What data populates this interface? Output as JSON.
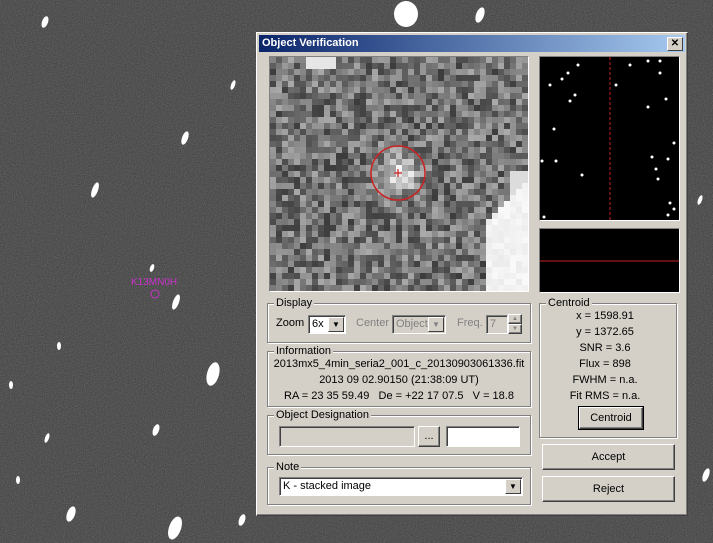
{
  "background": {
    "object_label": "K13MN0H"
  },
  "dialog": {
    "title": "Object Verification",
    "close_icon": "close-icon"
  },
  "display": {
    "group_label": "Display",
    "zoom_label": "Zoom",
    "zoom_value": "6x",
    "center_label": "Center",
    "center_value": "Object",
    "freq_label": "Freq.",
    "freq_value": "7"
  },
  "information": {
    "group_label": "Information",
    "filename": "2013mx5_4min_seria2_001_c_20130903061336.fit",
    "date": "2013 09 02.90150 (21:38:09 UT)",
    "coords": "RA = 23 35 59.49   De = +22 17 07.5   V = 18.8"
  },
  "designation": {
    "group_label": "Object Designation",
    "browse_label": "...",
    "field1_value": "",
    "field2_value": ""
  },
  "note": {
    "group_label": "Note",
    "value": "K - stacked image"
  },
  "centroid": {
    "group_label": "Centroid",
    "x": "x = 1598.91",
    "y": "y = 1372.65",
    "snr": "SNR = 3.6",
    "flux": "Flux = 898",
    "fwhm": "FWHM = n.a.",
    "fit_rms": "Fit RMS = n.a.",
    "button": "Centroid"
  },
  "actions": {
    "accept": "Accept",
    "reject": "Reject"
  },
  "colors": {
    "dialog_bg": "#d4d0c8",
    "title_gradient_start": "#0a246a",
    "title_gradient_end": "#a6caf0",
    "marker": "#cc2222",
    "object_label": "#cc33cc"
  }
}
